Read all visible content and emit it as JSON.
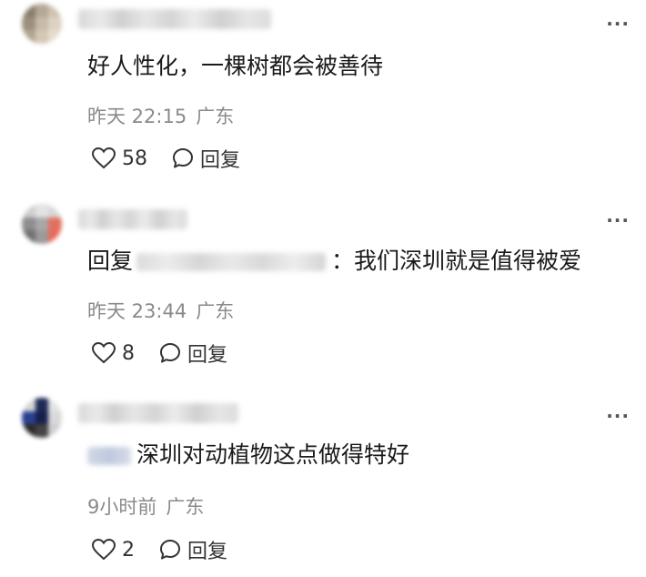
{
  "comments": [
    {
      "content": "好人性化，一棵树都会被善待",
      "time": "昨天 22:15",
      "location": "广东",
      "likes": "58",
      "reply_label": "回复"
    },
    {
      "content_prefix": "回复",
      "content": "：我们深圳就是值得被爱",
      "time": "昨天 23:44",
      "location": "广东",
      "likes": "8",
      "reply_label": "回复"
    },
    {
      "content": "深圳对动植物这点做得特好",
      "time": "9小时前",
      "location": "广东",
      "likes": "2",
      "reply_label": "回复"
    }
  ],
  "more_glyph": "···"
}
